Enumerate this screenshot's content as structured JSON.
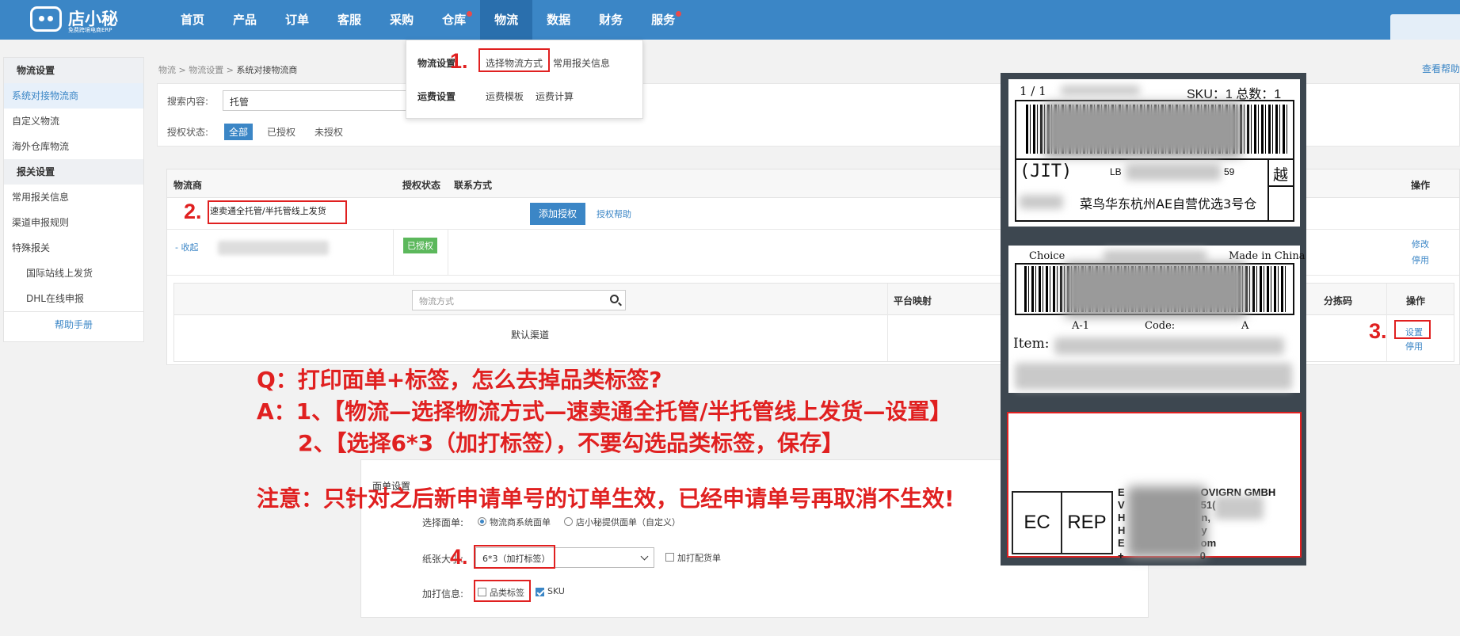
{
  "brand": {
    "name": "店小秘",
    "tagline": "免费跨境电商ERP"
  },
  "nav": {
    "items": [
      {
        "label": "首页",
        "dot": false
      },
      {
        "label": "产品",
        "dot": false
      },
      {
        "label": "订单",
        "dot": false
      },
      {
        "label": "客服",
        "dot": false
      },
      {
        "label": "采购",
        "dot": false
      },
      {
        "label": "仓库",
        "dot": true
      },
      {
        "label": "物流",
        "dot": false,
        "active": true
      },
      {
        "label": "数据",
        "dot": false
      },
      {
        "label": "财务",
        "dot": false
      },
      {
        "label": "服务",
        "dot": true
      }
    ]
  },
  "dropdown": {
    "group1": "物流设置",
    "choose_method": "选择物流方式",
    "common_customs": "常用报关信息",
    "group2": "运费设置",
    "freight_template": "运费模板",
    "freight_calc": "运费计算"
  },
  "sidebar": {
    "items": [
      {
        "label": "物流设置",
        "type": "head"
      },
      {
        "label": "系统对接物流商",
        "type": "active"
      },
      {
        "label": "自定义物流",
        "type": "item"
      },
      {
        "label": "海外仓库物流",
        "type": "item"
      },
      {
        "label": "报关设置",
        "type": "head"
      },
      {
        "label": "常用报关信息",
        "type": "item"
      },
      {
        "label": "渠道申报规则",
        "type": "item"
      },
      {
        "label": "特殊报关",
        "type": "item"
      },
      {
        "label": "国际站线上发货",
        "type": "sub"
      },
      {
        "label": "DHL在线申报",
        "type": "sub"
      },
      {
        "label": "帮助手册",
        "type": "help"
      }
    ]
  },
  "breadcrumb": {
    "part1": "物流",
    "part2": "物流设置",
    "current": "系统对接物流商",
    "sep": " > "
  },
  "help_link": "查看帮助",
  "filter": {
    "search_label": "搜索内容:",
    "search_value": "托管",
    "auth_label": "授权状态:",
    "auth_options": [
      "全部",
      "已授权",
      "未授权"
    ],
    "auth_selected": "全部"
  },
  "table": {
    "headers": {
      "carrier": "物流商",
      "auth_status": "授权状态",
      "contact": "联系方式",
      "ops": "操作"
    },
    "carrier_name": "速卖通全托管/半托管线上发货",
    "add_auth": "添加授权",
    "auth_help": "授权帮助",
    "collapse": "- 收起",
    "authorized_badge": "已授权",
    "modify": "修改",
    "disable": "停用",
    "inner": {
      "search_placeholder": "物流方式",
      "platform_mapping": "平台映射",
      "sort_code": "分拣码",
      "ops": "操作",
      "default_channel": "默认渠道",
      "setup": "设置",
      "disable": "停用"
    }
  },
  "panel": {
    "title": "面单设置",
    "select_label": "选择面单:",
    "radio1": "物流商系统面单",
    "radio2": "店小秘提供面单（自定义）",
    "paper_label": "纸张大小:",
    "paper_value": "6*3（加打标签）",
    "extra_cb": "加打配货单",
    "print_label": "加打信息:",
    "category_cb": "品类标签",
    "sku_cb": "SKU"
  },
  "steps": {
    "s1": "1.",
    "s2": "2.",
    "s3": "3.",
    "s4": "4."
  },
  "annotation": {
    "q": "Q：打印面单+标签，怎么去掉品类标签?",
    "a1": "A：1、【物流—选择物流方式—速卖通全托管/半托管线上发货—设置】",
    "a2": "2、【选择6*3（加打标签），不要勾选品类标签，保存】",
    "note": "注意：只针对之后新申请单号的订单生效，已经申请单号再取消不生效!"
  },
  "labels": {
    "label1": {
      "page": "1 / 1",
      "sku_total": "SKU：1 总数：1",
      "jit": "(JIT)",
      "lb_prefix": "LB",
      "lb_suffix": "59",
      "yue": "越",
      "warehouse": "菜鸟华东杭州AE自营优选3号仓"
    },
    "label2": {
      "choice": "Choice",
      "made_in": "Made in China",
      "a1": "A-1",
      "code": "Code:",
      "code_val": "A",
      "item": "Item:"
    },
    "label3": {
      "ec": "EC",
      "rep": "REP",
      "line1": "E",
      "line1b": "OVIGRN GMBH",
      "line2": "V",
      "line2b": "51(",
      "line3": "H",
      "line3b": "n,",
      "line4": "H",
      "line4b": "y",
      "line5": "E",
      "line5b": "om",
      "line6": "+",
      "line6b": "0"
    }
  },
  "colors": {
    "brand": "#3b86c6",
    "annotation": "#e02020",
    "authorized": "#5cb85c"
  }
}
